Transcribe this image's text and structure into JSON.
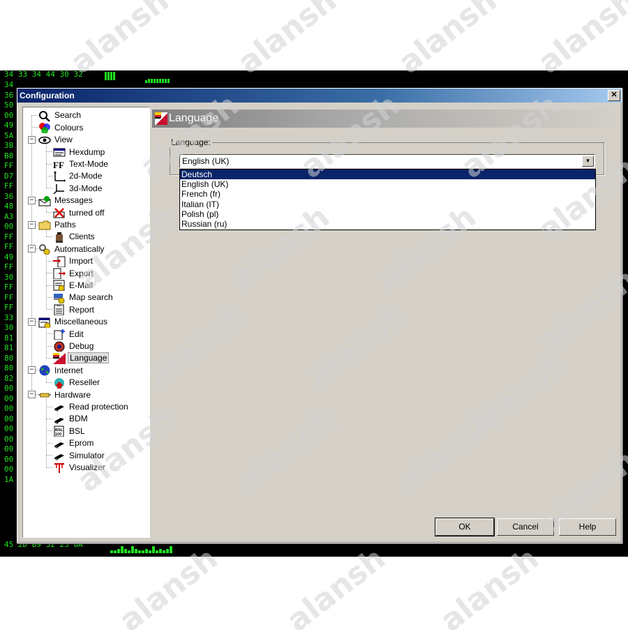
{
  "background": {
    "hex_prefixes": [
      "34",
      "36",
      "50",
      "00",
      "49",
      "5A",
      "3B",
      "B8",
      "FF",
      "D7",
      "FF",
      "36",
      "48",
      "A3",
      "00",
      "FF",
      "FF",
      "49",
      "FF",
      "30",
      "FF",
      "FF",
      "FF",
      "33",
      "30",
      "81",
      "81",
      "80",
      "80",
      "82",
      "00",
      "00",
      "00",
      "00",
      "00",
      "00",
      "00",
      "00",
      "00",
      "1A"
    ],
    "top_row": "34 33 34 44 30 32",
    "bottom_row": "45 2D B9 32 23 8A",
    "accent_color": "#1fe01f"
  },
  "window": {
    "title": "Configuration",
    "close_glyph": "✕"
  },
  "tree": {
    "items": [
      {
        "label": "Search",
        "icon": "search-icon",
        "level": 0
      },
      {
        "label": "Colours",
        "icon": "colours-icon",
        "level": 0
      },
      {
        "label": "View",
        "icon": "eye-icon",
        "level": 0,
        "expander": "−"
      },
      {
        "label": "Hexdump",
        "icon": "hexdump-icon",
        "level": 1
      },
      {
        "label": "Text-Mode",
        "icon": "text-mode-icon",
        "level": 1
      },
      {
        "label": "2d-Mode",
        "icon": "2d-mode-icon",
        "level": 1
      },
      {
        "label": "3d-Mode",
        "icon": "3d-mode-icon",
        "level": 1
      },
      {
        "label": "Messages",
        "icon": "messages-icon",
        "level": 0,
        "expander": "−"
      },
      {
        "label": "turned off",
        "icon": "turned-off-icon",
        "level": 1
      },
      {
        "label": "Paths",
        "icon": "folder-icon",
        "level": 0,
        "expander": "−"
      },
      {
        "label": "Clients",
        "icon": "clients-icon",
        "level": 1
      },
      {
        "label": "Automatically",
        "icon": "automatically-icon",
        "level": 0,
        "expander": "−"
      },
      {
        "label": "Import",
        "icon": "import-icon",
        "level": 1
      },
      {
        "label": "Export",
        "icon": "export-icon",
        "level": 1
      },
      {
        "label": "E-Mail",
        "icon": "email-icon",
        "level": 1
      },
      {
        "label": "Map search",
        "icon": "map-search-icon",
        "level": 1
      },
      {
        "label": "Report",
        "icon": "report-icon",
        "level": 1
      },
      {
        "label": "Miscellaneous",
        "icon": "miscellaneous-icon",
        "level": 0,
        "expander": "−"
      },
      {
        "label": "Edit",
        "icon": "edit-icon",
        "level": 1
      },
      {
        "label": "Debug",
        "icon": "debug-icon",
        "level": 1
      },
      {
        "label": "Language",
        "icon": "language-flag-icon",
        "level": 1,
        "selected": true
      },
      {
        "label": "Internet",
        "icon": "globe-icon",
        "level": 0,
        "expander": "−"
      },
      {
        "label": "Reseller",
        "icon": "reseller-icon",
        "level": 1
      },
      {
        "label": "Hardware",
        "icon": "hardware-icon",
        "level": 0,
        "expander": "−"
      },
      {
        "label": "Read protection",
        "icon": "chip-icon",
        "level": 1
      },
      {
        "label": "BDM",
        "icon": "chip-icon",
        "level": 1
      },
      {
        "label": "BSL",
        "icon": "bsl-icon",
        "level": 1
      },
      {
        "label": "Eprom",
        "icon": "chip-icon",
        "level": 1
      },
      {
        "label": "Simulator",
        "icon": "chip-icon",
        "level": 1
      },
      {
        "label": "Visualizer",
        "icon": "visualizer-icon",
        "level": 1
      }
    ]
  },
  "panel": {
    "title": "Language",
    "group_label": "Language:",
    "selected_value": "English (UK)",
    "options": [
      "Deutsch",
      "English (UK)",
      "French (fr)",
      "Italian (IT)",
      "Polish (pl)",
      "Russian (ru)"
    ],
    "highlighted_option": 0
  },
  "buttons": {
    "ok": "OK",
    "cancel": "Cancel",
    "help": "Help"
  },
  "watermark": "alansh"
}
